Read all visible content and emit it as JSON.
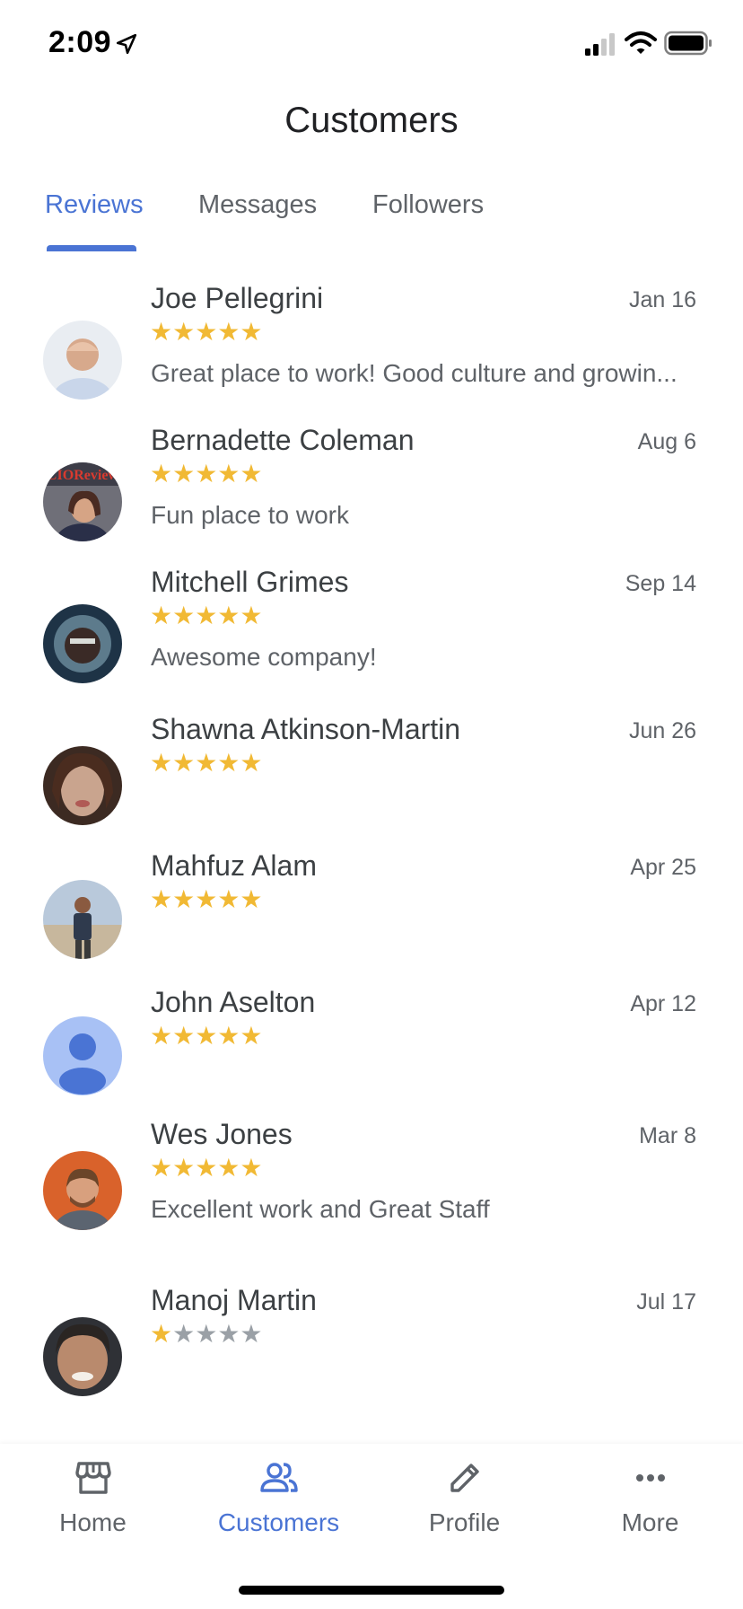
{
  "status_bar": {
    "time": "2:09"
  },
  "header": {
    "title": "Customers"
  },
  "tabs": [
    {
      "label": "Reviews",
      "active": true
    },
    {
      "label": "Messages",
      "active": false
    },
    {
      "label": "Followers",
      "active": false
    }
  ],
  "reviews": [
    {
      "name": "Joe Pellegrini",
      "date": "Jan 16",
      "rating": 5,
      "text": "Great place to work! Good culture and growin..."
    },
    {
      "name": "Bernadette Coleman",
      "date": "Aug 6",
      "rating": 5,
      "text": "Fun place to work"
    },
    {
      "name": "Mitchell Grimes",
      "date": "Sep 14",
      "rating": 5,
      "text": "Awesome company!"
    },
    {
      "name": "Shawna Atkinson-Martin",
      "date": "Jun 26",
      "rating": 5,
      "text": ""
    },
    {
      "name": "Mahfuz Alam",
      "date": "Apr 25",
      "rating": 5,
      "text": ""
    },
    {
      "name": "John Aselton",
      "date": "Apr 12",
      "rating": 5,
      "text": ""
    },
    {
      "name": "Wes Jones",
      "date": "Mar 8",
      "rating": 5,
      "text": "Excellent work and Great Staff"
    },
    {
      "name": "Manoj Martin",
      "date": "Jul 17",
      "rating": 1,
      "text": ""
    }
  ],
  "avatar_badge_text": "CIOReview",
  "bottom_nav": [
    {
      "label": "Home",
      "icon": "store-icon",
      "active": false
    },
    {
      "label": "Customers",
      "icon": "people-icon",
      "active": true
    },
    {
      "label": "Profile",
      "icon": "pencil-icon",
      "active": false
    },
    {
      "label": "More",
      "icon": "more-horizontal-icon",
      "active": false
    }
  ],
  "colors": {
    "accent": "#4a74d4",
    "star": "#f1b934",
    "star_empty": "#9aa0a6",
    "text_primary": "#3c4043",
    "text_secondary": "#5f6368"
  }
}
